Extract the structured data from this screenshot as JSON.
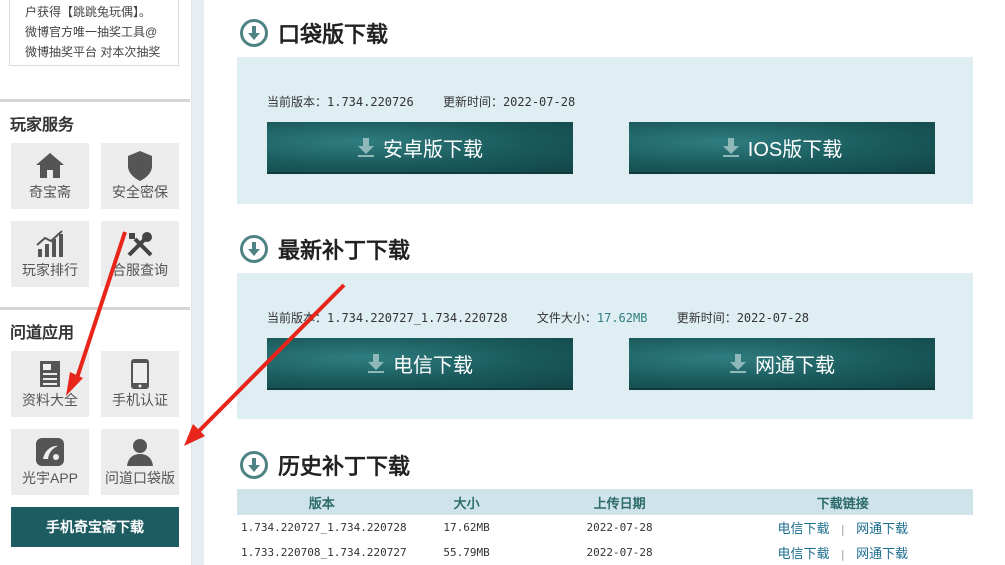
{
  "notice": {
    "lines": [
      "户获得【跳跳兔玩偶】。",
      "微博官方唯一抽奖工具@",
      "微博抽奖平台 对本次抽奖"
    ]
  },
  "player_service": {
    "title": "玩家服务",
    "tiles": [
      {
        "label": "奇宝斋",
        "icon": "home-icon"
      },
      {
        "label": "安全密保",
        "icon": "shield-icon"
      },
      {
        "label": "玩家排行",
        "icon": "bar-chart-icon"
      },
      {
        "label": "合服查询",
        "icon": "tools-icon"
      }
    ]
  },
  "wendao_apps": {
    "title": "问道应用",
    "tiles": [
      {
        "label": "资料大全",
        "icon": "document-icon"
      },
      {
        "label": "手机认证",
        "icon": "phone-icon"
      },
      {
        "label": "光宇APP",
        "icon": "app-logo-icon"
      },
      {
        "label": "问道口袋版",
        "icon": "user-icon"
      }
    ],
    "mobile_download": "手机奇宝斋下载"
  },
  "pocket": {
    "title": "口袋版下载",
    "version_label": "当前版本：1.734.220726",
    "update_label": "更新时间：2022-07-28",
    "android_btn": "安卓版下载",
    "ios_btn": "IOS版下载"
  },
  "patch": {
    "title": "最新补丁下载",
    "version_label": "当前版本：1.734.220727_1.734.220728",
    "size_prefix": "文件大小：",
    "size_value": "17.62MB",
    "update_label": "更新时间：2022-07-28",
    "telecom_btn": "电信下载",
    "netcom_btn": "网通下载"
  },
  "history": {
    "title": "历史补丁下载",
    "headers": [
      "版本",
      "大小",
      "上传日期",
      "下载链接"
    ],
    "rows": [
      {
        "version": "1.734.220727_1.734.220728",
        "size": "17.62MB",
        "date": "2022-07-28",
        "link1": "电信下载",
        "link2": "网通下载"
      },
      {
        "version": "1.733.220708_1.734.220727",
        "size": "55.79MB",
        "date": "2022-07-28",
        "link1": "电信下载",
        "link2": "网通下载"
      }
    ],
    "separator": "|"
  },
  "colors": {
    "accent": "#1d5c60",
    "panel_bg": "#dfeef3",
    "annotation": "#e8251b"
  }
}
